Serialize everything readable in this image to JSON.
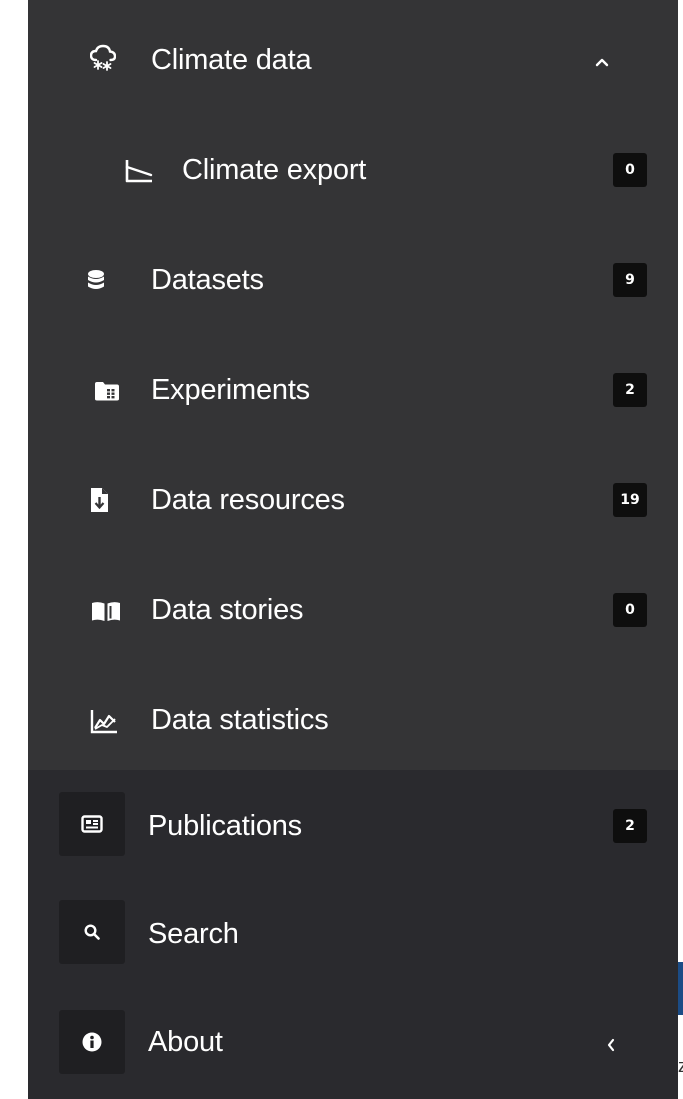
{
  "sidebar": {
    "climate_data": {
      "label": "Climate data",
      "icon": "cloud-snow-icon",
      "chevron": "up"
    },
    "sub_items": [
      {
        "label": "Climate export",
        "icon": "chart-axis-icon",
        "count": "0"
      },
      {
        "label": "Datasets",
        "icon": "database-icon",
        "count": "9"
      },
      {
        "label": "Experiments",
        "icon": "folder-table-icon",
        "count": "2"
      },
      {
        "label": "Data resources",
        "icon": "file-download-icon",
        "count": "19"
      },
      {
        "label": "Data stories",
        "icon": "book-open-icon",
        "count": "0"
      },
      {
        "label": "Data statistics",
        "icon": "area-chart-icon"
      }
    ],
    "main_items": [
      {
        "label": "Publications",
        "icon": "newspaper-icon",
        "count": "2"
      },
      {
        "label": "Search",
        "icon": "search-icon"
      },
      {
        "label": "About",
        "icon": "info-icon",
        "chevron": "left"
      }
    ]
  },
  "peek": {
    "text": "z"
  },
  "colors": {
    "sidebar_bg": "#2a2a2e",
    "submenu_bg": "#343436",
    "badge_bg": "#0e0e0e",
    "icon_tile_bg": "#1f1f22",
    "text": "#ffffff",
    "peek_accent": "#1b4c86"
  }
}
